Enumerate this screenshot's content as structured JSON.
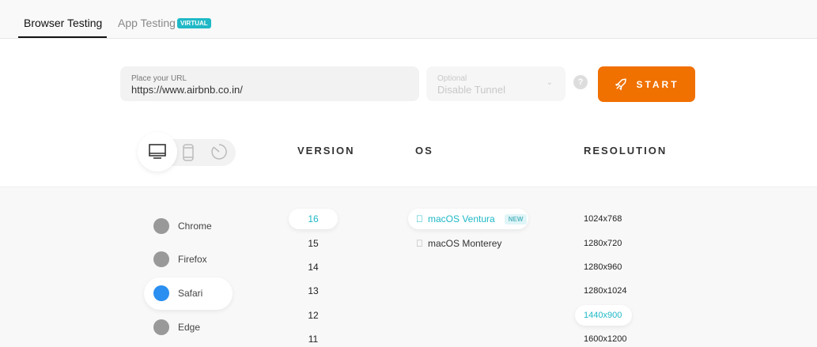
{
  "tabs": {
    "browser": "Browser Testing",
    "app": "App Testing",
    "app_badge": "VIRTUAL"
  },
  "url": {
    "label": "Place your URL",
    "value": "https://www.airbnb.co.in/"
  },
  "tunnel": {
    "label": "Optional",
    "value": "Disable Tunnel"
  },
  "help": "?",
  "start": "START",
  "headers": {
    "version": "VERSION",
    "os": "OS",
    "resolution": "RESOLUTION"
  },
  "browsers": [
    "Chrome",
    "Firefox",
    "Safari",
    "Edge"
  ],
  "selected_browser": "Safari",
  "versions": [
    "16",
    "15",
    "14",
    "13",
    "12",
    "11"
  ],
  "os": [
    {
      "name": "macOS Ventura",
      "badge": "NEW"
    },
    {
      "name": "macOS Monterey"
    }
  ],
  "resolutions": [
    "1024x768",
    "1280x720",
    "1280x960",
    "1280x1024",
    "1440x900",
    "1600x1200"
  ],
  "colors": {
    "accent": "#1fb8c6",
    "start": "#f07000"
  }
}
